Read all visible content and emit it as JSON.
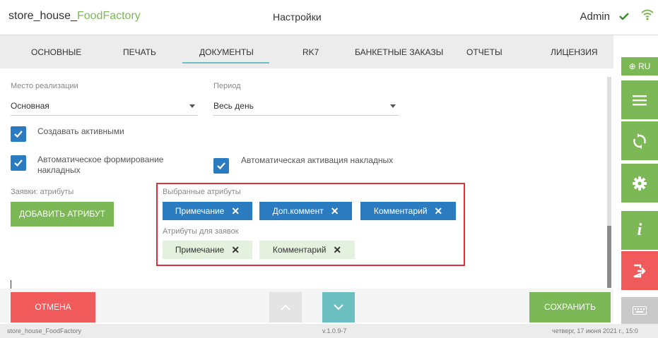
{
  "header": {
    "app_prefix": "store_house_",
    "app_accent": "FoodFactory",
    "page_title": "Настройки",
    "user": "Admin",
    "status_icon": "check-icon",
    "network_icon": "wifi-icon"
  },
  "tabs": [
    {
      "label": "ОСНОВНЫЕ",
      "active": false
    },
    {
      "label": "ПЕЧАТЬ",
      "active": false
    },
    {
      "label": "ДОКУМЕНТЫ",
      "active": true
    },
    {
      "label": "RK7",
      "active": false
    },
    {
      "label": "БАНКЕТНЫЕ ЗАКАЗЫ",
      "active": false
    },
    {
      "label": "ОТЧЕТЫ",
      "active": false
    },
    {
      "label": "ЛИЦЕНЗИЯ",
      "active": false
    }
  ],
  "sidebar": {
    "lang_label": "RU",
    "buttons": [
      "menu-icon",
      "sync-icon",
      "gear-icon",
      "info-icon",
      "logout-icon",
      "keyboard-icon"
    ]
  },
  "form": {
    "place_label": "Место реализации",
    "place_value": "Основная",
    "period_label": "Период",
    "period_value": "Весь день",
    "create_active": {
      "label": "Создавать активными",
      "checked": true
    },
    "auto_form": {
      "label_line1": "Автоматическое формирование",
      "label_line2": "накладных",
      "checked": true
    },
    "auto_activate": {
      "label": "Автоматическая активация накладных",
      "checked": true
    },
    "requests_label": "Заявки: атрибуты",
    "add_attribute": "ДОБАВИТЬ АТРИБУТ",
    "selected_label": "Выбранные атрибуты",
    "selected": [
      "Примечание",
      "Доп.коммент",
      "Комментарий"
    ],
    "available_label": "Атрибуты для заявок",
    "available": [
      "Примечание",
      "Комментарий"
    ],
    "remove_glyph": "✕"
  },
  "footer": {
    "cancel": "ОТМЕНА",
    "save": "СОХРАНИТЬ"
  },
  "statusbar": {
    "app": "store_house_FoodFactory",
    "version": "v.1.0.9-7",
    "datetime": "четверг, 17 июня 2021 г., 15:0"
  },
  "colors": {
    "green": "#7cb856",
    "blue": "#2b7bc0",
    "teal": "#6bbfc1",
    "red": "#f15a5a",
    "highlight": "#d9323b"
  }
}
